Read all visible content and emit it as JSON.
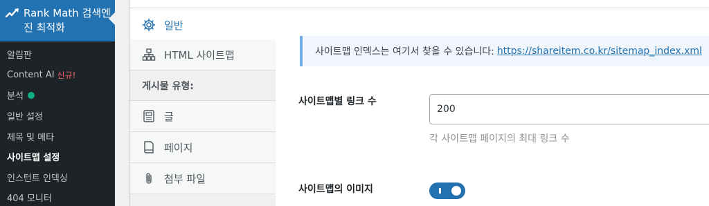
{
  "sidebar": {
    "plugin_title": "Rank Math 검색엔진 최적화",
    "items": [
      {
        "label": "알림판"
      },
      {
        "label": "Content AI",
        "badge": "신규!"
      },
      {
        "label": "분석"
      },
      {
        "label": "일반 설정"
      },
      {
        "label": "제목 및 메타"
      },
      {
        "label": "사이트맵 설정"
      },
      {
        "label": "인스턴트 인덱싱"
      },
      {
        "label": "404 모니터"
      }
    ]
  },
  "tabs": [
    {
      "label": "일반",
      "icon": "gear-icon"
    },
    {
      "label": "HTML 사이트맵",
      "icon": "sitemap-icon"
    },
    {
      "label": "게시물 유형:"
    },
    {
      "label": "글",
      "icon": "post-icon"
    },
    {
      "label": "페이지",
      "icon": "page-icon"
    },
    {
      "label": "첨부 파일",
      "icon": "paperclip-icon"
    }
  ],
  "notice": {
    "text": "사이트맵 인덱스는 여기서 찾을 수 있습니다:",
    "link": "https://shareitem.co.kr/sitemap_index.xml"
  },
  "fields": {
    "links_per_sitemap": {
      "label": "사이트맵별 링크 수",
      "value": "200",
      "description": "각 사이트맵 페이지의 최대 링크 수"
    },
    "images_in_sitemap": {
      "label": "사이트맵의 이미지",
      "enabled": true
    }
  },
  "colors": {
    "sidebar_bg": "#1d2327",
    "accent": "#2271b1",
    "status_dot": "#10ac84",
    "new_badge": "#f86368"
  }
}
